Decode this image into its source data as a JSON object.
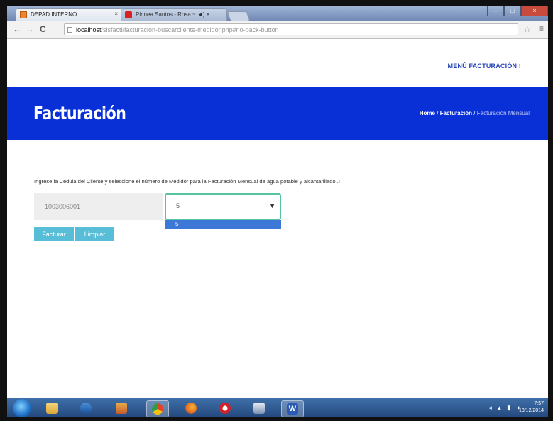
{
  "browser": {
    "tabs": [
      {
        "title": "DEPAD INTERNO",
        "close": "×"
      },
      {
        "title": "Pirinea Santos - Rosa ~ ◄) ×",
        "close": ""
      }
    ],
    "nav": {
      "back": "←",
      "forward": "→",
      "reload": "C"
    },
    "url": {
      "host": "localhost",
      "path": "/sisfacti/facturacion-buscarcliente-medidor.php#no-back-button"
    },
    "window_controls": {
      "minimize": "–",
      "maximize": "□",
      "close": "×"
    },
    "star": "☆",
    "menu": "≡"
  },
  "header": {
    "menu_link": "MENÚ FACTURACIÓN ⁝"
  },
  "banner": {
    "title": "Facturación",
    "breadcrumb": {
      "home": "Home",
      "sep1": "/",
      "section": "Facturación",
      "sep2": "/",
      "current": "Facturación Mensual"
    }
  },
  "form": {
    "instruction": "Ingrese la Cédula del Cliente y seleccione el número de Medidor para la Facturación Mensual de agua potable y alcantarillado..!",
    "cedula_value": "1003006001",
    "medidor_selected": "5",
    "medidor_options": [
      "5"
    ],
    "buttons": {
      "facturar": "Facturar",
      "limpiar": "Limpiar"
    }
  },
  "taskbar": {
    "clock_time": "7:57",
    "clock_date": "13/12/2014",
    "colors": {
      "chrome": "#e0442b",
      "firefox": "#e66a1d",
      "opera": "#d0222b",
      "word": "#2a5ab3",
      "banner": "#0930d6",
      "button": "#58bed8"
    }
  }
}
